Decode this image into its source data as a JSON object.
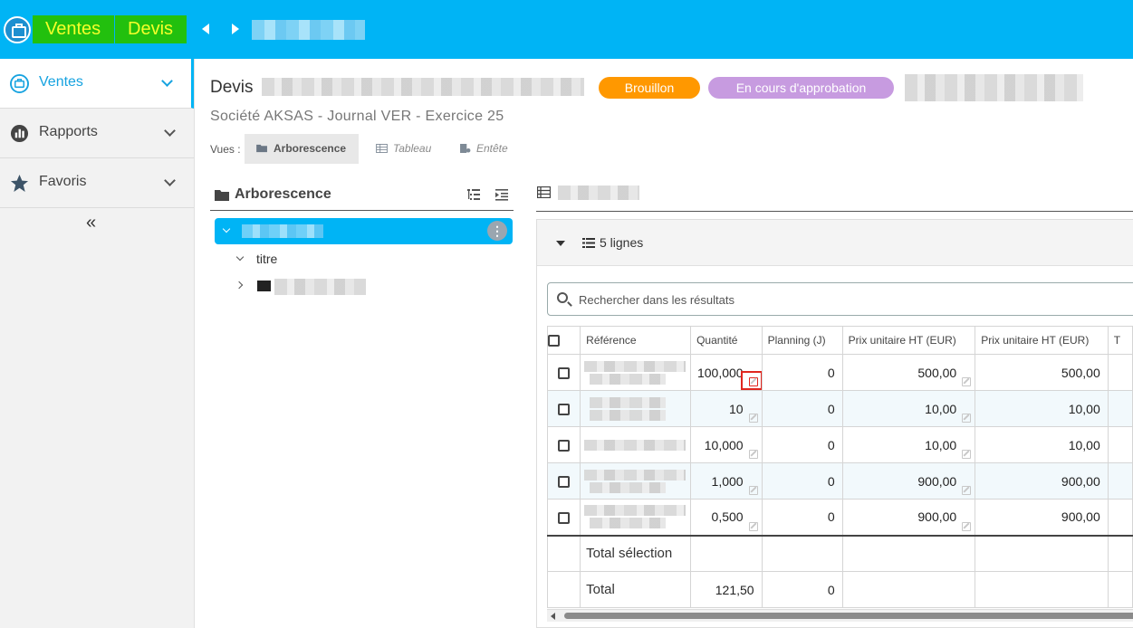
{
  "topbar": {
    "breadcrumb": [
      "Ventes",
      "Devis"
    ]
  },
  "sidebar": {
    "items": [
      {
        "label": "Ventes",
        "icon": "briefcase-icon",
        "active": true
      },
      {
        "label": "Rapports",
        "icon": "bar-chart-icon",
        "active": false
      },
      {
        "label": "Favoris",
        "icon": "star-icon",
        "active": false
      }
    ],
    "collapse_label": "«"
  },
  "header": {
    "doc_type": "Devis",
    "status_badges": [
      "Brouillon",
      "En cours d'approbation"
    ],
    "meta": "Société AKSAS -  Journal VER -  Exercice 25",
    "views_label": "Vues :",
    "views": [
      "Arborescence",
      "Tableau",
      "Entête"
    ]
  },
  "tree": {
    "title": "Arborescence",
    "child_label": "titre",
    "kebab": "⋮"
  },
  "lines": {
    "count_label": "5 lignes",
    "search_placeholder": "Rechercher dans les résultats",
    "columns": [
      "Référence",
      "Quantité",
      "Planning (J)",
      "Prix unitaire HT (EUR)",
      "Prix unitaire HT (EUR)",
      "T"
    ],
    "rows": [
      {
        "qty": "100,000",
        "planning": "0",
        "pu_ht": "500,00",
        "pu_ht2": "500,00"
      },
      {
        "qty": "10",
        "planning": "0",
        "pu_ht": "10,00",
        "pu_ht2": "10,00"
      },
      {
        "qty": "10,000",
        "planning": "0",
        "pu_ht": "10,00",
        "pu_ht2": "10,00"
      },
      {
        "qty": "1,000",
        "planning": "0",
        "pu_ht": "900,00",
        "pu_ht2": "900,00"
      },
      {
        "qty": "0,500",
        "planning": "0",
        "pu_ht": "900,00",
        "pu_ht2": "900,00"
      }
    ],
    "total_selection_label": "Total sélection",
    "total_label": "Total",
    "total_qty": "121,50",
    "total_planning": "0"
  },
  "colors": {
    "topbar": "#00b4f5",
    "breadcrumb_bg": "#22c00e",
    "breadcrumb_text": "#f4ff2a",
    "badge_draft": "#ff9800",
    "badge_approval": "#c79be0"
  }
}
